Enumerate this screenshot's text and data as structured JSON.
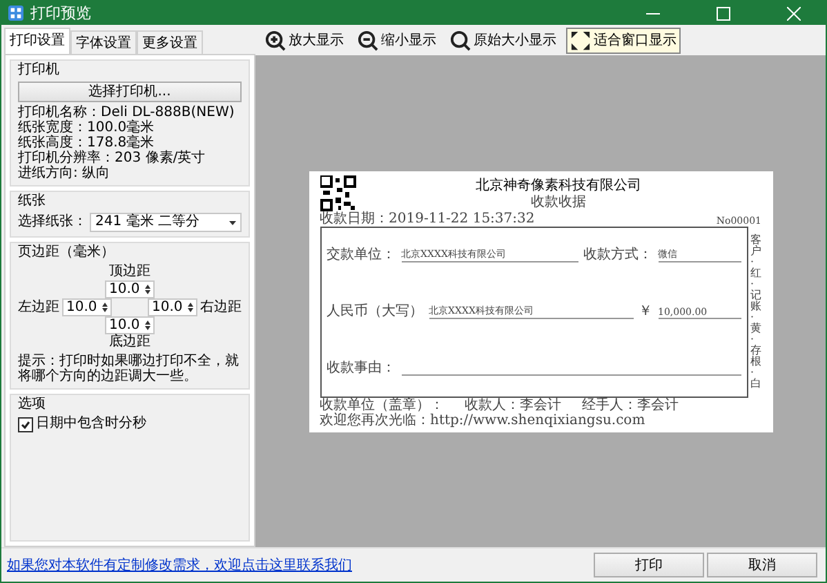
{
  "window": {
    "title": "打印预览"
  },
  "tabs": [
    {
      "label": "打印设置",
      "selected": true
    },
    {
      "label": "字体设置",
      "selected": false
    },
    {
      "label": "更多设置",
      "selected": false
    }
  ],
  "printer_group": {
    "title": "打印机",
    "button": "选择打印机...",
    "info": [
      "打印机名称：Deli DL-888B(NEW)",
      "纸张宽度：100.0毫米",
      "纸张高度：178.8毫米",
      "打印机分辨率：203 像素/英寸",
      "进纸方向: 纵向"
    ]
  },
  "paper_group": {
    "title": "纸张",
    "label": "选择纸张：",
    "select_value": "241 毫米 二等分"
  },
  "margin_group": {
    "title": "页边距（毫米）",
    "top_label": "顶边距",
    "top_value": "10.0",
    "left_label": "左边距",
    "left_value": "10.0",
    "right_value": "10.0",
    "right_label": "右边距",
    "bottom_value": "10.0",
    "bottom_label": "底边距",
    "hint": "提示：打印时如果哪边打印不全，就将哪个方向的边距调大一些。"
  },
  "options_group": {
    "title": "选项",
    "checkbox": {
      "label": "日期中包含时分秒",
      "checked": true
    }
  },
  "toolbar": [
    {
      "kind": "zoom-in",
      "label": "放大显示",
      "selected": false
    },
    {
      "kind": "zoom-out",
      "label": "缩小显示",
      "selected": false
    },
    {
      "kind": "actual",
      "label": "原始大小显示",
      "selected": false
    },
    {
      "kind": "fit",
      "label": "适合窗口显示",
      "selected": true
    }
  ],
  "receipt": {
    "company": "北京神奇像素科技有限公司",
    "subtitle": "收款收据",
    "date": "收款日期：2019-11-22 15:37:32",
    "number": "No00001",
    "rows": [
      {
        "label": "交款单位：",
        "value": "北京XXXX科技有限公司",
        "right_label": "收款方式：",
        "right_value": "微信"
      },
      {
        "label": "人民币（大写）",
        "value": "北京XXXX科技有限公司",
        "right_label": "￥",
        "right_value": "10,000.00"
      },
      {
        "label": "收款事由："
      }
    ],
    "side_text": "客户·红·记账·黄·存根·白",
    "signatures": [
      "收款单位（盖章）：",
      "收款人：李会计",
      "经手人：李会计"
    ],
    "website": "欢迎您再次光临：http://www.shenqixiangsu.com"
  },
  "footer": {
    "link": "如果您对本软件有定制修改需求，欢迎点击这里联系我们",
    "buttons": [
      "打印",
      "取消"
    ]
  }
}
